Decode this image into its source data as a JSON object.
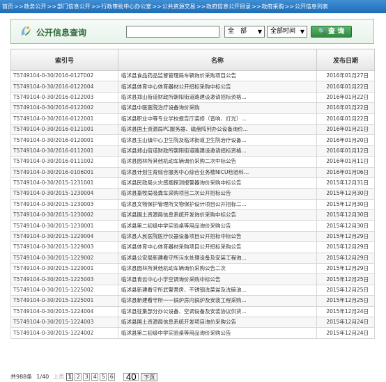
{
  "breadcrumb": [
    "首页",
    "政务公开",
    "部门信息公开",
    "行政审批中心办公室",
    "公共资源交易",
    "政府信息公开目录",
    "政府采购",
    "公开信息列表"
  ],
  "breadcrumb_separator": ">>",
  "panel": {
    "title": "公开信息查询",
    "search_value": "",
    "scope_select": "全　部",
    "time_select": "全部时间",
    "query_button": "查 询"
  },
  "table": {
    "headers": [
      "索引号",
      "名称",
      "发布日期"
    ],
    "rows": [
      {
        "id": "T5749104-0-30/2016-012T002",
        "name": "临沭县食品药品监督管理局车辆询价采购项目公告",
        "date": "2016年01月27日"
      },
      {
        "id": "T5749104-0-30/2016-0122004",
        "name": "临沭县体育中心体育器材公开招标采购中标公告",
        "date": "2016年01月22日"
      },
      {
        "id": "T5749104-0-30/2016-0122003",
        "name": "临沭县郑山街道财政所朝阳街道路建设邀请招标资格...",
        "date": "2016年01月22日"
      },
      {
        "id": "T5749104-0-30/2016-0122002",
        "name": "临沭县中医医院治疗设备询价采购",
        "date": "2016年01月22日"
      },
      {
        "id": "T5749104-0-30/2016-0122001",
        "name": "临沭县职业中等专业学校报告厅装修（音响、灯光）...",
        "date": "2016年01月22日"
      },
      {
        "id": "T5749104-0-30/2016-0121001",
        "name": "临沭县国土资源局PC服务器、磁盘阵列办公设备询价...",
        "date": "2016年01月21日"
      },
      {
        "id": "T5749104-0-30/2016-0120001",
        "name": "临沭县玉山镇中心卫生院及临沭街道卫生院治疗设备...",
        "date": "2016年01月20日"
      },
      {
        "id": "T5749104-0-30/2016-0112001",
        "name": "临沭县郑山街道财政所朝阳街道路建设邀请招标资格...",
        "date": "2016年01月12日"
      },
      {
        "id": "T5749104-0-30/2016-0111002",
        "name": "临沭县园林所其他机动车辆询价采购二次中标公告",
        "date": "2016年01月11日"
      },
      {
        "id": "T5749104-0-30/2016-0106001",
        "name": "临沭县计划生育综合服务中心综合业务楼NICU检验科...",
        "date": "2016年01月06日"
      },
      {
        "id": "T5749104-0-30/2015-1231001",
        "name": "临沭县民政局火灾感烟探测报警器询价采购中标公告",
        "date": "2015年12月31日"
      },
      {
        "id": "T5749104-0-30/2015-1230004",
        "name": "临沭县畜牧局吸粪车采购项目二次公开招标公告",
        "date": "2015年12月30日"
      },
      {
        "id": "T5749104-0-30/2015-1230003",
        "name": "临沭县文物保护管理所文物保护设计项目公开招标二...",
        "date": "2015年12月30日"
      },
      {
        "id": "T5749104-0-30/2015-1230002",
        "name": "临沭县国土资源局信息系统开发询价采购中标公告",
        "date": "2015年12月30日"
      },
      {
        "id": "T5749104-0-30/2015-1230001",
        "name": "临沭县第二初级中学实验桌等用品询价采购公告",
        "date": "2015年12月30日"
      },
      {
        "id": "T5749104-0-30/2015-1229004",
        "name": "临沭县人民医院医疗仪器设备项目公开招标中标公告",
        "date": "2015年12月29日"
      },
      {
        "id": "T5749104-0-30/2015-1229003",
        "name": "临沭县体育中心体育器材采购项目公开招标采购公告",
        "date": "2015年12月29日"
      },
      {
        "id": "T5749104-0-30/2015-1229002",
        "name": "临沭县公安局新建看守所污水处理设备及安装工程询...",
        "date": "2015年12月29日"
      },
      {
        "id": "T5749104-0-30/2015-1229001",
        "name": "临沭县园林所其他机动车辆询价采购公告二次",
        "date": "2015年12月29日"
      },
      {
        "id": "T5749104-0-30/2015-1225003",
        "name": "临沭县青云中心小学空调询价采购中标公告",
        "date": "2015年12月25日"
      },
      {
        "id": "T5749104-0-30/2015-1225002",
        "name": "临沭县新建看守所武警营房、不锈钢洗菜盆及洗碗池...",
        "date": "2015年12月25日"
      },
      {
        "id": "T5749104-0-30/2015-1225001",
        "name": "临沭县新建看守所一一锅炉房内锅炉及安装工程采购...",
        "date": "2015年12月25日"
      },
      {
        "id": "T5749104-0-30/2015-1224004",
        "name": "临沭县征集部分办公设备、空调设备及安装协议供货...",
        "date": "2015年12月24日"
      },
      {
        "id": "T5749104-0-30/2015-1224003",
        "name": "临沭县国土资源局信息系统开发项目询价采购公告",
        "date": "2015年12月24日"
      },
      {
        "id": "T5749104-0-30/2015-1224002",
        "name": "临沭县第二初级中学实验桌等用品询价采购公告",
        "date": "2015年12月24日"
      }
    ]
  },
  "pager": {
    "total": "共988条",
    "page_info": "1/40",
    "prev": "上页",
    "pages": [
      "1",
      "2",
      "3",
      "4",
      "5",
      "6"
    ],
    "current": "1",
    "jump_value": "40",
    "next": "下页"
  },
  "colors": {
    "breadcrumb_bg": "#1f6cb8",
    "panel_title": "#2f6b3a",
    "query_button": "#2f8a40"
  },
  "icons": {
    "logo": "info-logo-icon",
    "query": "search-icon",
    "dropdown": "chevron-down-icon"
  }
}
